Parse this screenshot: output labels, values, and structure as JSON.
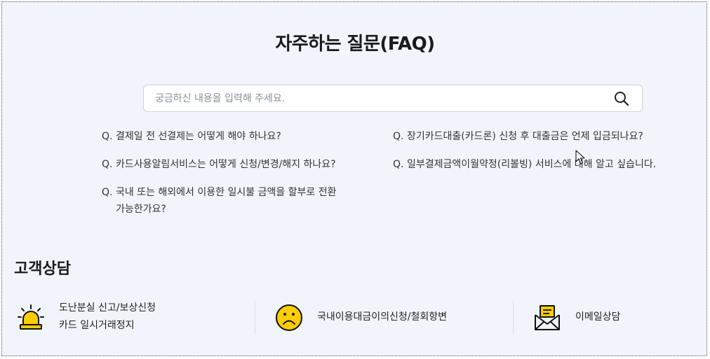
{
  "faq": {
    "title": "자주하는 질문(FAQ)",
    "search_placeholder": "궁금하신 내용을 입력해 주세요.",
    "questions": [
      {
        "prefix": "Q.",
        "text": "결제일 전 선결제는 어떻게 해야 하나요?"
      },
      {
        "prefix": "Q.",
        "text": "장기카드대출(카드론) 신청 후 대출금은 언제 입금되나요?"
      },
      {
        "prefix": "Q.",
        "text": "카드사용알림서비스는 어떻게 신청/변경/해지 하나요?"
      },
      {
        "prefix": "Q.",
        "text": "일부결제금액이월약정(리볼빙) 서비스에 대해 알고 싶습니다."
      },
      {
        "prefix": "Q.",
        "text_line1": "국내 또는 해외에서 이용한 일시불 금액을 할부로 전환",
        "text_line2": "가능한가요?"
      }
    ]
  },
  "customer_service": {
    "title": "고객상담",
    "items": [
      {
        "icon": "siren-icon",
        "line1": "도난분실 신고/보상신청",
        "line2": "카드 일시거래정지"
      },
      {
        "icon": "sad-face-icon",
        "line1": "국내이용대금이의신청/철회항변"
      },
      {
        "icon": "email-icon",
        "line1": "이메일상담"
      }
    ]
  },
  "colors": {
    "background": "#f1f4fb",
    "accent_yellow": "#ffcc00"
  }
}
